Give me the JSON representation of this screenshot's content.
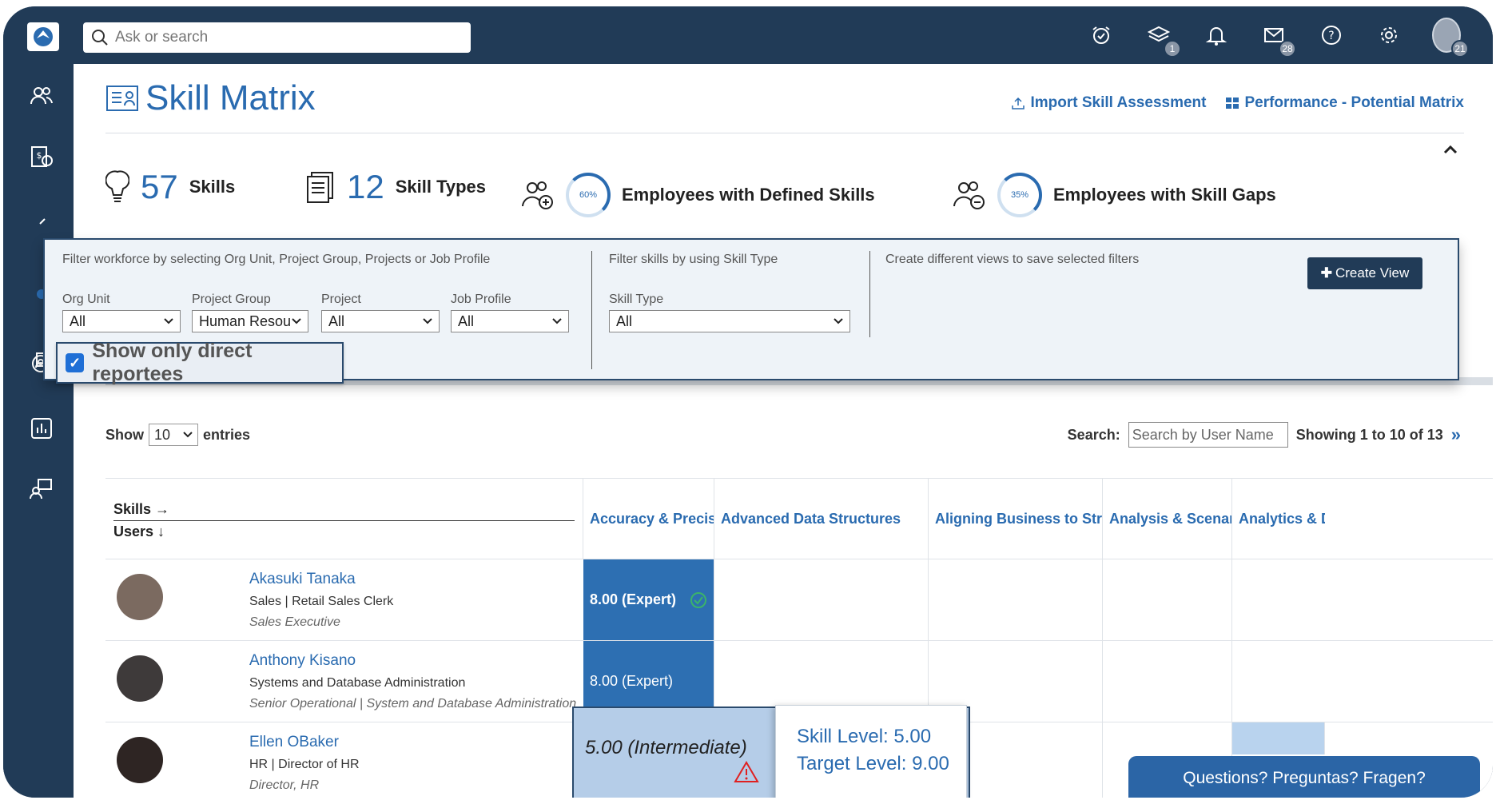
{
  "topbar": {
    "search_placeholder": "Ask or search",
    "icons": [
      {
        "name": "alarm-clock-icon"
      },
      {
        "name": "layers-icon",
        "badge": "1"
      },
      {
        "name": "bell-icon"
      },
      {
        "name": "mail-icon",
        "badge": "28"
      },
      {
        "name": "help-icon"
      },
      {
        "name": "gear-icon"
      }
    ],
    "avatar_badge": "21"
  },
  "page": {
    "title": "Skill Matrix",
    "import_link": "Import Skill Assessment",
    "perf_link": "Performance - Potential Matrix"
  },
  "stats": {
    "skills_count": "57",
    "skills_label": "Skills",
    "types_count": "12",
    "types_label": "Skill Types",
    "defined_pct": "60%",
    "defined_label": "Employees with Defined Skills",
    "gaps_pct": "35%",
    "gaps_label": "Employees with Skill Gaps"
  },
  "filters": {
    "workforce_note": "Filter workforce by selecting Org Unit, Project Group, Projects or Job Profile",
    "skill_note": "Filter skills by using Skill Type",
    "views_note": "Create different views to save selected filters",
    "org_unit_label": "Org Unit",
    "org_unit_value": "All",
    "project_group_label": "Project Group",
    "project_group_value": "Human Resou",
    "project_label": "Project",
    "project_value": "All",
    "job_profile_label": "Job Profile",
    "job_profile_value": "All",
    "skill_type_label": "Skill Type",
    "skill_type_value": "All",
    "create_view": "Create View",
    "direct_reportees": "Show only direct reportees"
  },
  "table_controls": {
    "show_label": "Show",
    "entries_value": "10",
    "entries_label": "entries",
    "search_label": "Search:",
    "search_placeholder": "Search by User Name",
    "showing": "Showing 1 to 10 of 13"
  },
  "matrix": {
    "skills_header": "Skills →",
    "users_header": "Users ↓",
    "columns": [
      "Accuracy & Precision",
      "Advanced Data Structures",
      "Aligning Business to Strategy",
      "Analysis & Scenarios",
      "Analytics & Dat"
    ],
    "rows": [
      {
        "name": "Akasuki Tanaka",
        "dept": "Sales | Retail Sales Clerk",
        "role": "Sales Executive",
        "score": "8.00 (Expert)"
      },
      {
        "name": "Anthony Kisano",
        "dept": "Systems and Database Administration",
        "role": "Senior Operational | System and Database Administration",
        "score": "8.00 (Expert)"
      },
      {
        "name": "Ellen OBaker",
        "dept": "HR | Director of HR",
        "role": "Director, HR",
        "score": "5.00 (Intermediate)"
      }
    ]
  },
  "tooltip": {
    "skill_level": "Skill Level: 5.00",
    "target_level": "Target Level: 9.00"
  },
  "chat": {
    "label": "Questions? Preguntas? Fragen?"
  },
  "colors": {
    "navy": "#213b57",
    "accent": "#2a6bb0",
    "expert": "#2d6fb2",
    "intermediate": "#b5cde8"
  }
}
